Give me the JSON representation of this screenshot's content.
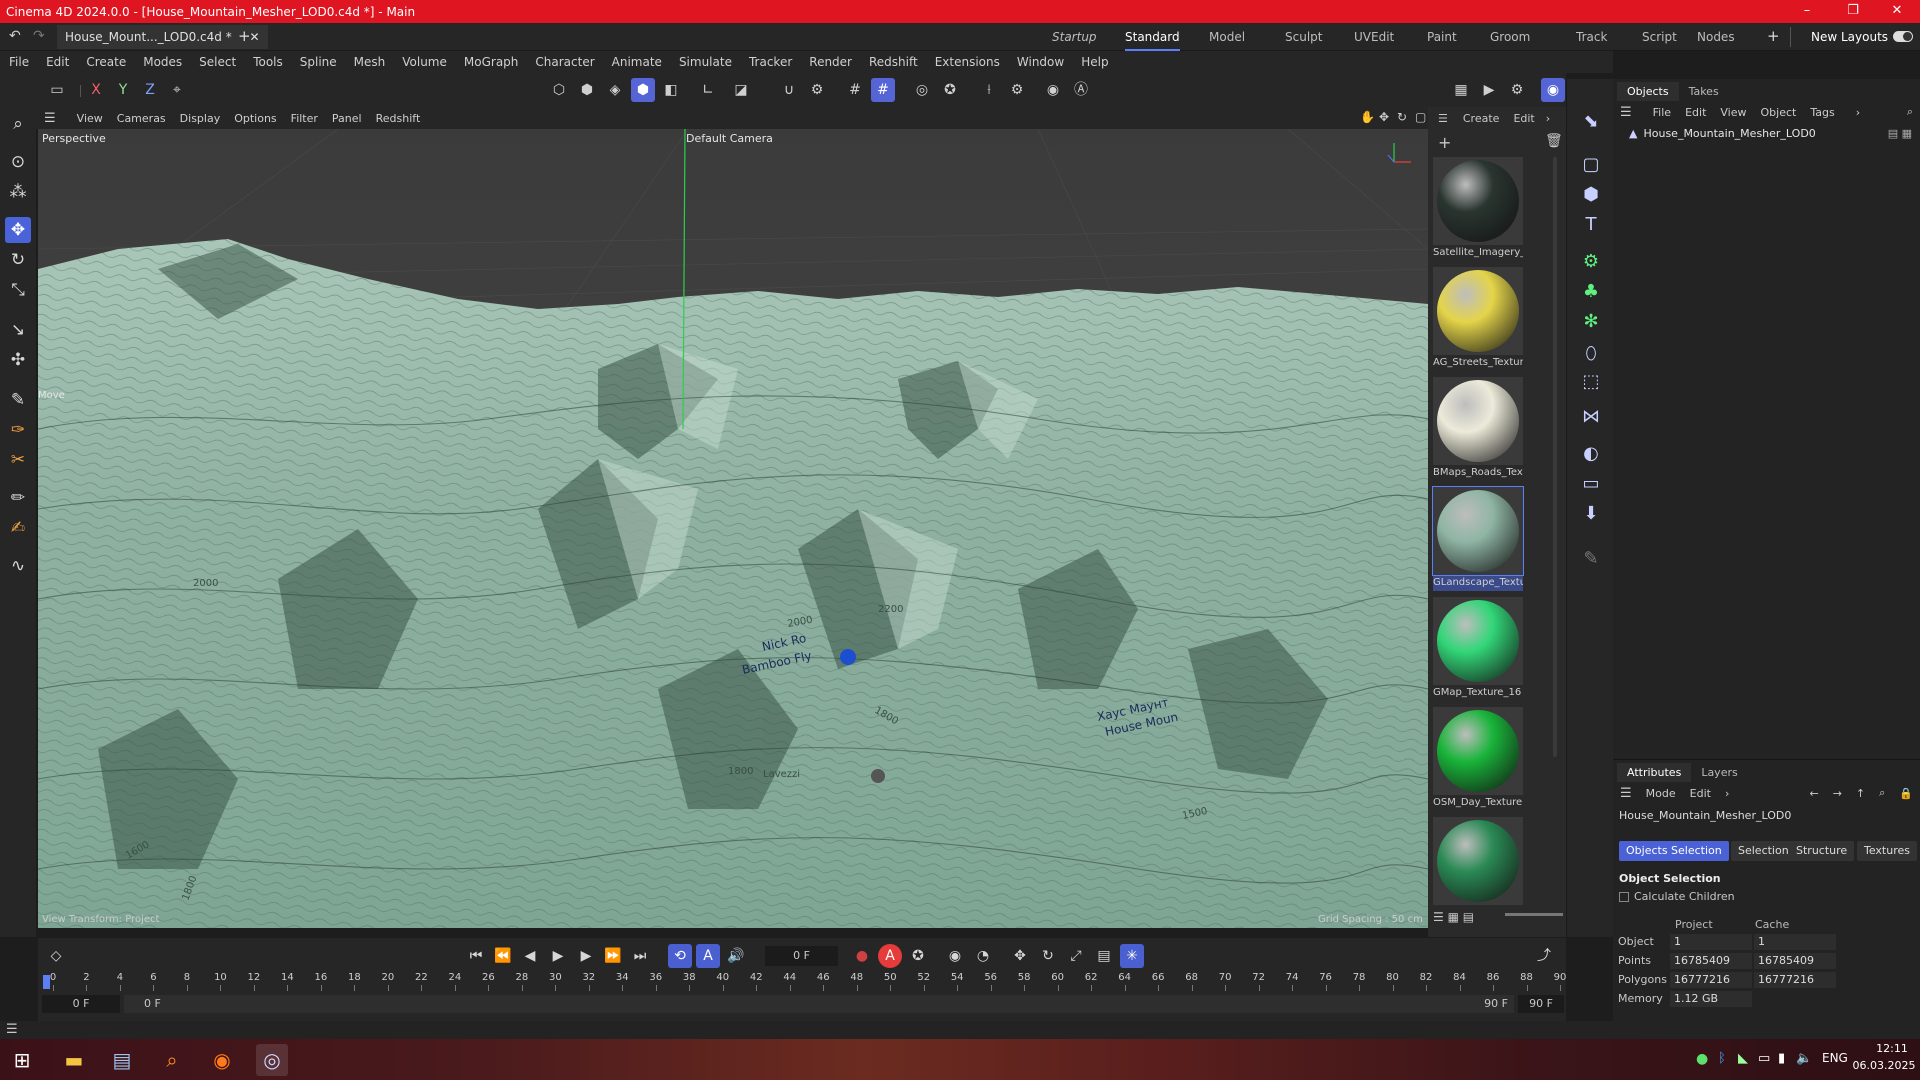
{
  "title_bar": {
    "text": "Cinema 4D 2024.0.0 - [House_Mountain_Mesher_LOD0.c4d *] - Main",
    "minimize": "–",
    "maximize": "❐",
    "close": "✕"
  },
  "doc_tab": {
    "label": "House_Mount..._LOD0.c4d *",
    "close": "✕",
    "new": "+"
  },
  "layouts": [
    "Startup",
    "Standard",
    "Model",
    "Sculpt",
    "UVEdit",
    "Paint",
    "Groom",
    "Track",
    "Script",
    "Nodes"
  ],
  "layouts_active": "Standard",
  "new_layouts": "New Layouts",
  "menu": [
    "File",
    "Edit",
    "Create",
    "Modes",
    "Select",
    "Tools",
    "Spline",
    "Mesh",
    "Volume",
    "MoGraph",
    "Character",
    "Animate",
    "Simulate",
    "Tracker",
    "Render",
    "Redshift",
    "Extensions",
    "Window",
    "Help"
  ],
  "axis_buttons": [
    "X",
    "Y",
    "Z"
  ],
  "viewport": {
    "menu": [
      "View",
      "Cameras",
      "Display",
      "Options",
      "Filter",
      "Panel",
      "Redshift"
    ],
    "mode_label": "Perspective",
    "camera_label": "Default Camera",
    "tool_label": "Move",
    "view_transform": "View Transform: Project",
    "grid_spacing": "Grid Spacing : 50 cm",
    "map_labels": [
      "Nick Ro",
      "Bamboo Fly",
      "2000",
      "2200",
      "1800",
      "1800",
      "Lavezzi",
      "1500",
      "2000",
      "1600",
      "1800",
      "Хаус Маунт",
      "House Moun"
    ]
  },
  "material_panel": {
    "menu": [
      "Create",
      "Edit"
    ],
    "materials": [
      {
        "name": "Satellite_Imagery_",
        "color": "#2a3530"
      },
      {
        "name": "AG_Streets_Textur",
        "color": "#e4d44a"
      },
      {
        "name": "BMaps_Roads_Tex",
        "color": "#ecead9"
      },
      {
        "name": "GLandscape_Textu",
        "color": "#8fb5a4"
      },
      {
        "name": "GMap_Texture_16",
        "color": "#32d678"
      },
      {
        "name": "OSM_Day_Texture",
        "color": "#19b43a"
      },
      {
        "name": "",
        "color": "#2a8a55"
      }
    ]
  },
  "objects_panel": {
    "tabs": [
      "Objects",
      "Takes"
    ],
    "menu": [
      "File",
      "Edit",
      "View",
      "Object",
      "Tags"
    ],
    "item": "House_Mountain_Mesher_LOD0"
  },
  "attributes_panel": {
    "tabs": [
      "Attributes",
      "Layers"
    ],
    "menu": [
      "Mode",
      "Edit"
    ],
    "object_name": "House_Mountain_Mesher_LOD0",
    "buttons": [
      "Objects Selection",
      "Selection",
      "Structure",
      "Textures"
    ],
    "section": "Object Selection",
    "checkbox_label": "Calculate Children",
    "col_project": "Project",
    "col_cache": "Cache",
    "rows": [
      {
        "label": "Object",
        "project": "1",
        "cache": "1"
      },
      {
        "label": "Points",
        "project": "16785409",
        "cache": "16785409"
      },
      {
        "label": "Polygons",
        "project": "16777216",
        "cache": "16777216"
      },
      {
        "label": "Memory",
        "project": "1.12 GB",
        "cache": ""
      }
    ]
  },
  "timeline": {
    "current_frame": "0 F",
    "ticks": [
      "0",
      "2",
      "4",
      "6",
      "8",
      "10",
      "12",
      "14",
      "16",
      "18",
      "20",
      "22",
      "24",
      "26",
      "28",
      "30",
      "32",
      "34",
      "36",
      "38",
      "40",
      "42",
      "44",
      "46",
      "48",
      "50",
      "52",
      "54",
      "56",
      "58",
      "60",
      "62",
      "64",
      "66",
      "68",
      "70",
      "72",
      "74",
      "76",
      "78",
      "80",
      "82",
      "84",
      "86",
      "88",
      "90"
    ],
    "start_field": "0 F",
    "start_field2": "0 F",
    "end_field": "90 F",
    "end_field2": "90 F"
  },
  "taskbar": {
    "time": "12:11",
    "date": "06.03.2025",
    "lang": "ENG"
  }
}
